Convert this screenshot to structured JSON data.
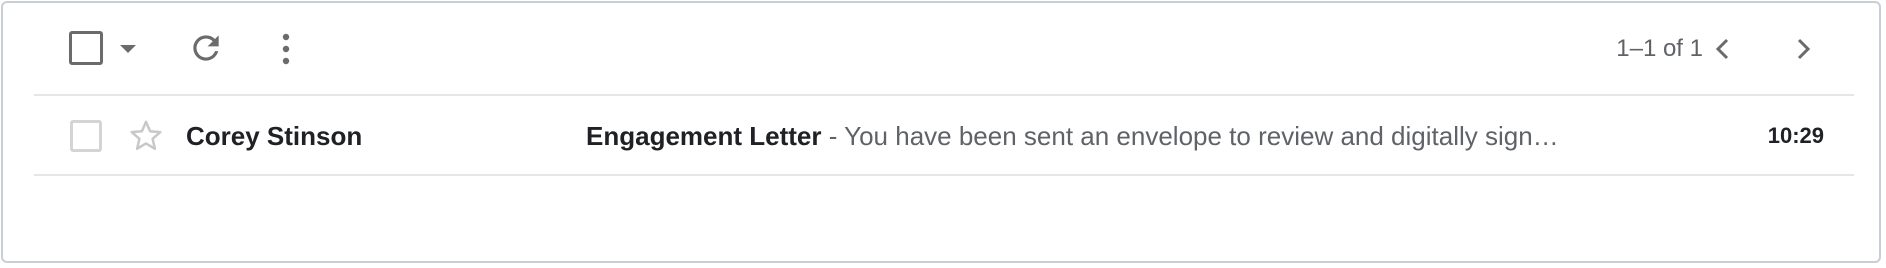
{
  "toolbar": {
    "select_all_icon": "checkbox-icon",
    "select_menu_icon": "caret-down-icon",
    "refresh_icon": "refresh-icon",
    "more_icon": "more-vert-icon",
    "range_text": "1–1 of 1",
    "prev_icon": "chevron-left-icon",
    "next_icon": "chevron-right-icon"
  },
  "messages": [
    {
      "sender": "Corey Stinson",
      "subject": "Engagement Letter",
      "separator": " - ",
      "snippet": "You have been sent an envelope to review and digitally sign…",
      "time": "10:29",
      "starred": false,
      "unread": true
    }
  ],
  "colors": {
    "border": "#c9ced6",
    "icon": "#6b6b6b",
    "divider": "#e6e6e6",
    "text_primary": "#202124",
    "text_secondary": "#5f6368"
  }
}
